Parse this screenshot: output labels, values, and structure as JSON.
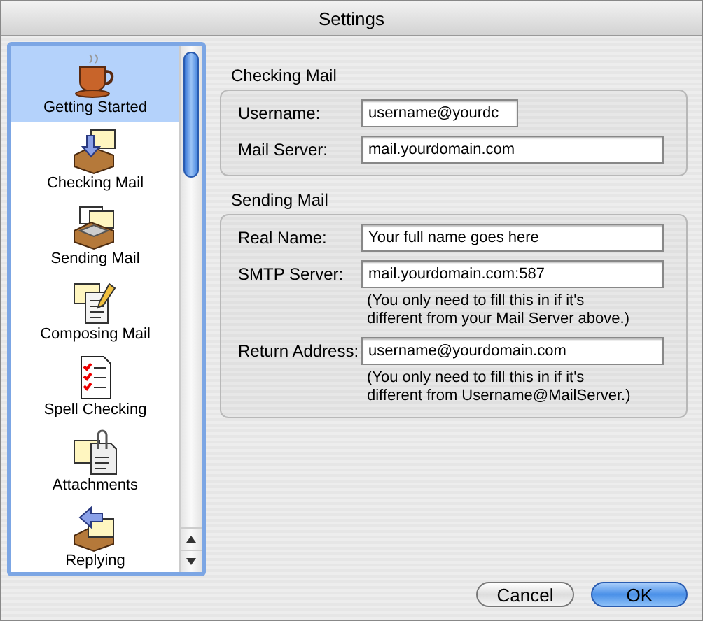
{
  "window": {
    "title": "Settings"
  },
  "sidebar": {
    "items": [
      {
        "label": "Getting Started",
        "selected": true
      },
      {
        "label": "Checking Mail",
        "selected": false
      },
      {
        "label": "Sending Mail",
        "selected": false
      },
      {
        "label": "Composing Mail",
        "selected": false
      },
      {
        "label": "Spell Checking",
        "selected": false
      },
      {
        "label": "Attachments",
        "selected": false
      },
      {
        "label": "Replying",
        "selected": false
      }
    ]
  },
  "groups": [
    {
      "title": "Checking Mail",
      "fields": [
        {
          "label": "Username:",
          "value": "username@yourdc",
          "kind": "short"
        },
        {
          "label": "Mail Server:",
          "value": "mail.yourdomain.com",
          "kind": "full"
        }
      ]
    },
    {
      "title": "Sending Mail",
      "fields": [
        {
          "label": "Real Name:",
          "value": "Your full name goes here",
          "kind": "full"
        },
        {
          "label": "SMTP Server:",
          "value": "mail.yourdomain.com:587",
          "kind": "full",
          "hint": "(You only need to fill this in if it's\ndifferent from your Mail Server above.)"
        },
        {
          "label": "Return Address:",
          "value": "username@yourdomain.com",
          "kind": "full",
          "hint": "(You only need to fill this in if it's\ndifferent from Username@MailServer.)"
        }
      ]
    }
  ],
  "buttons": [
    {
      "label": "Cancel",
      "kind": "normal"
    },
    {
      "label": "OK",
      "kind": "default"
    }
  ]
}
